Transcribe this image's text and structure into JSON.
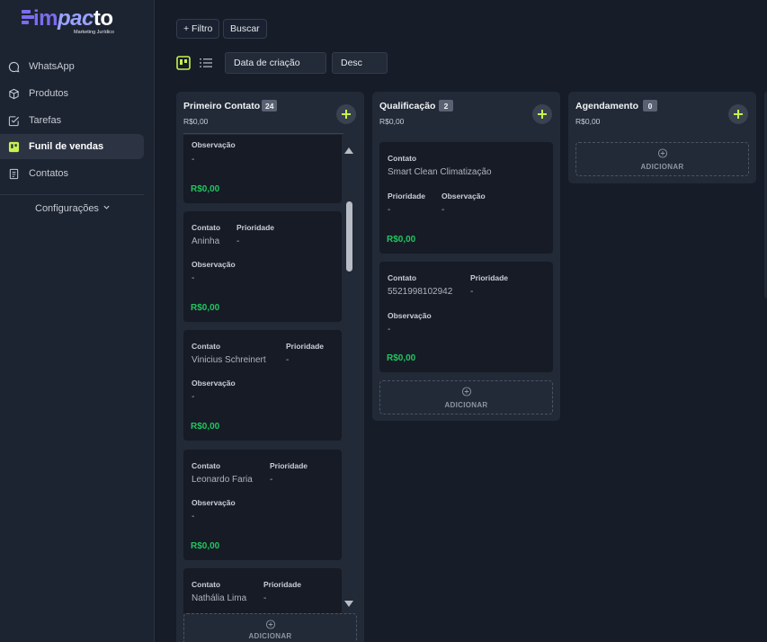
{
  "app": {
    "logo": {
      "part1": "im",
      "part2": "pac",
      "part3": "to",
      "tagline": "Marketing Jurídico"
    }
  },
  "sidebar": {
    "items": [
      {
        "label": "WhatsApp",
        "icon": "chat-bubble-icon"
      },
      {
        "label": "Produtos",
        "icon": "package-icon"
      },
      {
        "label": "Tarefas",
        "icon": "checkbox-icon"
      },
      {
        "label": "Funil de vendas",
        "icon": "kanban-icon",
        "active": true
      },
      {
        "label": "Contatos",
        "icon": "contact-book-icon"
      }
    ],
    "config_label": "Configurações"
  },
  "toolbar": {
    "filter_label": "+ Filtro",
    "search_label": "Buscar",
    "sort_field": "Data de criação",
    "sort_order": "Desc"
  },
  "colors": {
    "accent": "#c6f24e",
    "money": "#22c55e",
    "logo": "#7b6cf0"
  },
  "labels": {
    "contato": "Contato",
    "prioridade": "Prioridade",
    "observacao": "Observação",
    "adicionar": "ADICIONAR"
  },
  "columns": [
    {
      "title": "Primeiro Contato",
      "count": "24",
      "total": "R$0,00",
      "cards": [
        {
          "observacao": "-",
          "valor": "R$0,00"
        },
        {
          "contato": "Aninha",
          "prioridade": "-",
          "observacao": "-",
          "valor": "R$0,00"
        },
        {
          "contato": "Vinicius Schreinert",
          "prioridade": "-",
          "observacao": "-",
          "valor": "R$0,00"
        },
        {
          "contato": "Leonardo Faria",
          "prioridade": "-",
          "observacao": "-",
          "valor": "R$0,00"
        },
        {
          "contato": "Nathália Lima",
          "prioridade": "-"
        }
      ]
    },
    {
      "title": "Qualificação",
      "count": "2",
      "total": "R$0,00",
      "cards": [
        {
          "contato": "Smart Clean Climatização",
          "prioridade": "-",
          "observacao": "-",
          "valor": "R$0,00"
        },
        {
          "contato": "5521998102942",
          "prioridade": "-",
          "observacao": "-",
          "valor": "R$0,00"
        }
      ]
    },
    {
      "title": "Agendamento",
      "count": "0",
      "total": "R$0,00",
      "cards": []
    }
  ]
}
